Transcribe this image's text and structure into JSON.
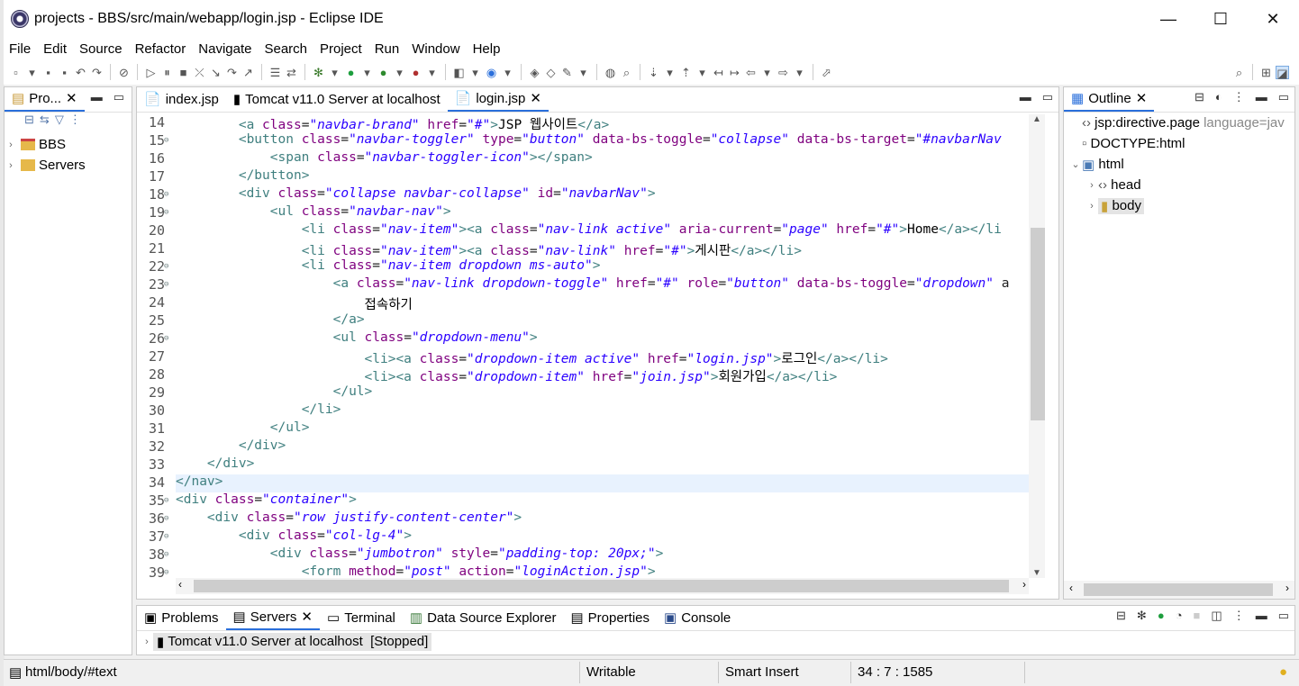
{
  "window": {
    "title": "projects - BBS/src/main/webapp/login.jsp - Eclipse IDE",
    "min": "—",
    "max": "☐",
    "close": "✕"
  },
  "menu": [
    "File",
    "Edit",
    "Source",
    "Refactor",
    "Navigate",
    "Search",
    "Project",
    "Run",
    "Window",
    "Help"
  ],
  "project_explorer": {
    "tab_label": "Pro...",
    "items": [
      {
        "label": "BBS"
      },
      {
        "label": "Servers"
      }
    ]
  },
  "editor": {
    "tabs": [
      {
        "label": "index.jsp",
        "active": false
      },
      {
        "label": "Tomcat v11.0 Server at localhost",
        "active": false
      },
      {
        "label": "login.jsp",
        "active": true
      }
    ],
    "lines": [
      {
        "n": "14",
        "fold": false,
        "html": "        <a class=\"navbar-brand\" href=\"#\">JSP 웹사이트</a>"
      },
      {
        "n": "15",
        "fold": true,
        "html": "        <button class=\"navbar-toggler\" type=\"button\" data-bs-toggle=\"collapse\" data-bs-target=\"#navbarNav"
      },
      {
        "n": "16",
        "fold": false,
        "html": "            <span class=\"navbar-toggler-icon\"></span>"
      },
      {
        "n": "17",
        "fold": false,
        "html": "        </button>"
      },
      {
        "n": "18",
        "fold": true,
        "html": "        <div class=\"collapse navbar-collapse\" id=\"navbarNav\">"
      },
      {
        "n": "19",
        "fold": true,
        "html": "            <ul class=\"navbar-nav\">"
      },
      {
        "n": "20",
        "fold": false,
        "html": "                <li class=\"nav-item\"><a class=\"nav-link active\" aria-current=\"page\" href=\"#\">Home</a></li"
      },
      {
        "n": "21",
        "fold": false,
        "html": "                <li class=\"nav-item\"><a class=\"nav-link\" href=\"#\">게시판</a></li>"
      },
      {
        "n": "22",
        "fold": true,
        "html": "                <li class=\"nav-item dropdown ms-auto\">"
      },
      {
        "n": "23",
        "fold": true,
        "html": "                    <a class=\"nav-link dropdown-toggle\" href=\"#\" role=\"button\" data-bs-toggle=\"dropdown\" a"
      },
      {
        "n": "24",
        "fold": false,
        "html": "                        접속하기"
      },
      {
        "n": "25",
        "fold": false,
        "html": "                    </a>"
      },
      {
        "n": "26",
        "fold": true,
        "html": "                    <ul class=\"dropdown-menu\">"
      },
      {
        "n": "27",
        "fold": false,
        "html": "                        <li><a class=\"dropdown-item active\" href=\"login.jsp\">로그인</a></li>"
      },
      {
        "n": "28",
        "fold": false,
        "html": "                        <li><a class=\"dropdown-item\" href=\"join.jsp\">회원가입</a></li>"
      },
      {
        "n": "29",
        "fold": false,
        "html": "                    </ul>"
      },
      {
        "n": "30",
        "fold": false,
        "html": "                </li>"
      },
      {
        "n": "31",
        "fold": false,
        "html": "            </ul>"
      },
      {
        "n": "32",
        "fold": false,
        "html": "        </div>"
      },
      {
        "n": "33",
        "fold": false,
        "html": "    </div>"
      },
      {
        "n": "34",
        "fold": false,
        "html": "</nav>"
      },
      {
        "n": "35",
        "fold": true,
        "html": "<div class=\"container\">"
      },
      {
        "n": "36",
        "fold": true,
        "html": "    <div class=\"row justify-content-center\">"
      },
      {
        "n": "37",
        "fold": true,
        "html": "        <div class=\"col-lg-4\">"
      },
      {
        "n": "38",
        "fold": true,
        "html": "            <div class=\"jumbotron\" style=\"padding-top: 20px;\">"
      },
      {
        "n": "39",
        "fold": true,
        "html": "                <form method=\"post\" action=\"loginAction.jsp\">"
      }
    ]
  },
  "outline": {
    "tab_label": "Outline",
    "items": [
      {
        "label": "jsp:directive.page",
        "extra": "language=jav"
      },
      {
        "label": "DOCTYPE:html",
        "extra": ""
      },
      {
        "label": "html",
        "extra": ""
      },
      {
        "label": "head",
        "extra": ""
      },
      {
        "label": "body",
        "extra": ""
      }
    ]
  },
  "bottom": {
    "tabs": [
      "Problems",
      "Servers",
      "Terminal",
      "Data Source Explorer",
      "Properties",
      "Console"
    ],
    "server_row": "Tomcat v11.0 Server at localhost  [Stopped]"
  },
  "status": {
    "path": "html/body/#text",
    "writable": "Writable",
    "insert": "Smart Insert",
    "position": "34 : 7 : 1585"
  }
}
